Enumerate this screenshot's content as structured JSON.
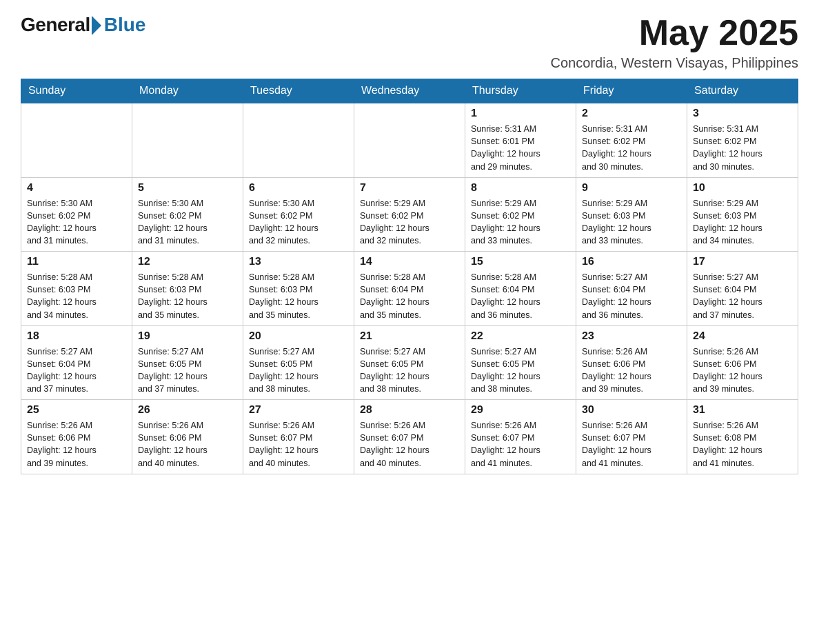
{
  "header": {
    "logo_general": "General",
    "logo_blue": "Blue",
    "month_year": "May 2025",
    "location": "Concordia, Western Visayas, Philippines"
  },
  "days_of_week": [
    "Sunday",
    "Monday",
    "Tuesday",
    "Wednesday",
    "Thursday",
    "Friday",
    "Saturday"
  ],
  "weeks": [
    [
      {
        "day": "",
        "info": ""
      },
      {
        "day": "",
        "info": ""
      },
      {
        "day": "",
        "info": ""
      },
      {
        "day": "",
        "info": ""
      },
      {
        "day": "1",
        "sunrise": "5:31 AM",
        "sunset": "6:01 PM",
        "daylight": "12 hours and 29 minutes."
      },
      {
        "day": "2",
        "sunrise": "5:31 AM",
        "sunset": "6:02 PM",
        "daylight": "12 hours and 30 minutes."
      },
      {
        "day": "3",
        "sunrise": "5:31 AM",
        "sunset": "6:02 PM",
        "daylight": "12 hours and 30 minutes."
      }
    ],
    [
      {
        "day": "4",
        "sunrise": "5:30 AM",
        "sunset": "6:02 PM",
        "daylight": "12 hours and 31 minutes."
      },
      {
        "day": "5",
        "sunrise": "5:30 AM",
        "sunset": "6:02 PM",
        "daylight": "12 hours and 31 minutes."
      },
      {
        "day": "6",
        "sunrise": "5:30 AM",
        "sunset": "6:02 PM",
        "daylight": "12 hours and 32 minutes."
      },
      {
        "day": "7",
        "sunrise": "5:29 AM",
        "sunset": "6:02 PM",
        "daylight": "12 hours and 32 minutes."
      },
      {
        "day": "8",
        "sunrise": "5:29 AM",
        "sunset": "6:02 PM",
        "daylight": "12 hours and 33 minutes."
      },
      {
        "day": "9",
        "sunrise": "5:29 AM",
        "sunset": "6:03 PM",
        "daylight": "12 hours and 33 minutes."
      },
      {
        "day": "10",
        "sunrise": "5:29 AM",
        "sunset": "6:03 PM",
        "daylight": "12 hours and 34 minutes."
      }
    ],
    [
      {
        "day": "11",
        "sunrise": "5:28 AM",
        "sunset": "6:03 PM",
        "daylight": "12 hours and 34 minutes."
      },
      {
        "day": "12",
        "sunrise": "5:28 AM",
        "sunset": "6:03 PM",
        "daylight": "12 hours and 35 minutes."
      },
      {
        "day": "13",
        "sunrise": "5:28 AM",
        "sunset": "6:03 PM",
        "daylight": "12 hours and 35 minutes."
      },
      {
        "day": "14",
        "sunrise": "5:28 AM",
        "sunset": "6:04 PM",
        "daylight": "12 hours and 35 minutes."
      },
      {
        "day": "15",
        "sunrise": "5:28 AM",
        "sunset": "6:04 PM",
        "daylight": "12 hours and 36 minutes."
      },
      {
        "day": "16",
        "sunrise": "5:27 AM",
        "sunset": "6:04 PM",
        "daylight": "12 hours and 36 minutes."
      },
      {
        "day": "17",
        "sunrise": "5:27 AM",
        "sunset": "6:04 PM",
        "daylight": "12 hours and 37 minutes."
      }
    ],
    [
      {
        "day": "18",
        "sunrise": "5:27 AM",
        "sunset": "6:04 PM",
        "daylight": "12 hours and 37 minutes."
      },
      {
        "day": "19",
        "sunrise": "5:27 AM",
        "sunset": "6:05 PM",
        "daylight": "12 hours and 37 minutes."
      },
      {
        "day": "20",
        "sunrise": "5:27 AM",
        "sunset": "6:05 PM",
        "daylight": "12 hours and 38 minutes."
      },
      {
        "day": "21",
        "sunrise": "5:27 AM",
        "sunset": "6:05 PM",
        "daylight": "12 hours and 38 minutes."
      },
      {
        "day": "22",
        "sunrise": "5:27 AM",
        "sunset": "6:05 PM",
        "daylight": "12 hours and 38 minutes."
      },
      {
        "day": "23",
        "sunrise": "5:26 AM",
        "sunset": "6:06 PM",
        "daylight": "12 hours and 39 minutes."
      },
      {
        "day": "24",
        "sunrise": "5:26 AM",
        "sunset": "6:06 PM",
        "daylight": "12 hours and 39 minutes."
      }
    ],
    [
      {
        "day": "25",
        "sunrise": "5:26 AM",
        "sunset": "6:06 PM",
        "daylight": "12 hours and 39 minutes."
      },
      {
        "day": "26",
        "sunrise": "5:26 AM",
        "sunset": "6:06 PM",
        "daylight": "12 hours and 40 minutes."
      },
      {
        "day": "27",
        "sunrise": "5:26 AM",
        "sunset": "6:07 PM",
        "daylight": "12 hours and 40 minutes."
      },
      {
        "day": "28",
        "sunrise": "5:26 AM",
        "sunset": "6:07 PM",
        "daylight": "12 hours and 40 minutes."
      },
      {
        "day": "29",
        "sunrise": "5:26 AM",
        "sunset": "6:07 PM",
        "daylight": "12 hours and 41 minutes."
      },
      {
        "day": "30",
        "sunrise": "5:26 AM",
        "sunset": "6:07 PM",
        "daylight": "12 hours and 41 minutes."
      },
      {
        "day": "31",
        "sunrise": "5:26 AM",
        "sunset": "6:08 PM",
        "daylight": "12 hours and 41 minutes."
      }
    ]
  ],
  "labels": {
    "sunrise": "Sunrise:",
    "sunset": "Sunset:",
    "daylight": "Daylight:"
  }
}
